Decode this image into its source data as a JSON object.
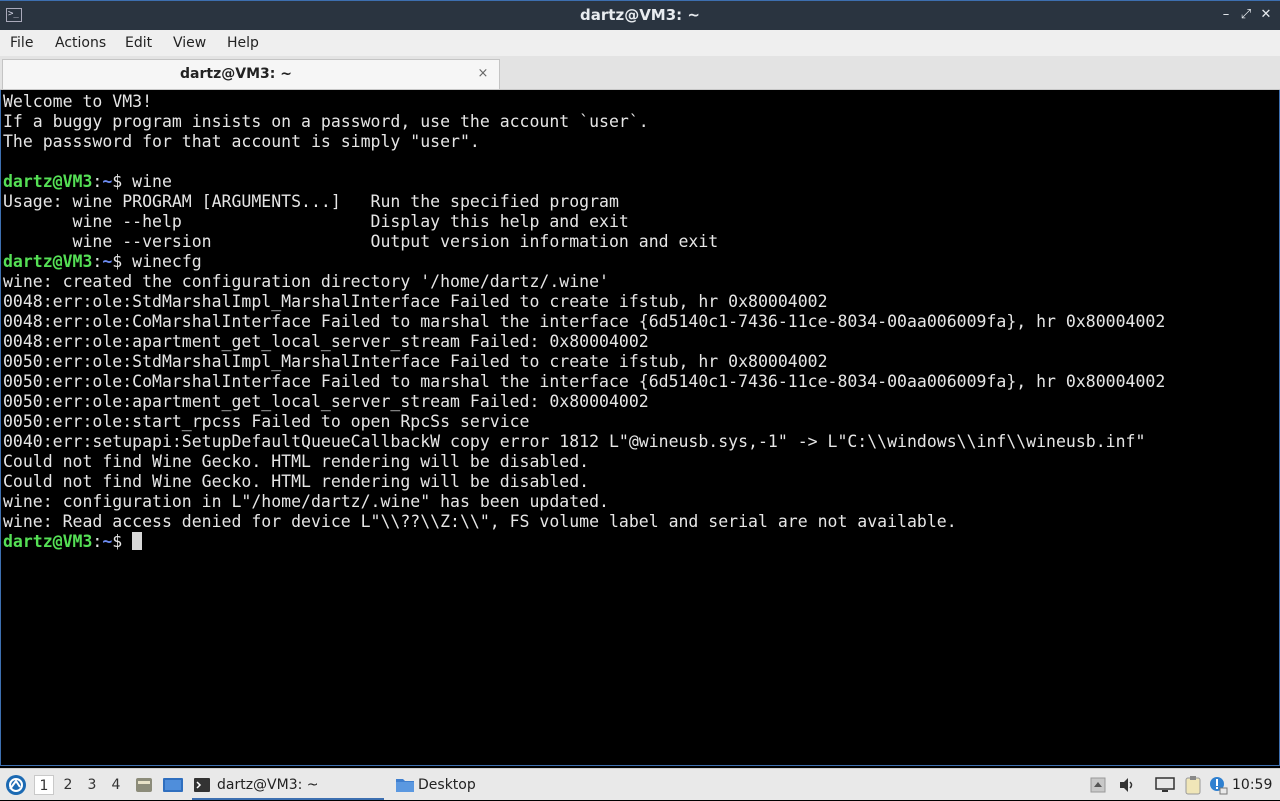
{
  "window": {
    "title": "dartz@VM3: ~",
    "app_icon": "terminal-icon",
    "buttons": [
      "minimize-icon",
      "maximize-icon",
      "close-icon"
    ]
  },
  "menu": [
    "File",
    "Actions",
    "Edit",
    "View",
    "Help"
  ],
  "tab": {
    "label": "dartz@VM3: ~",
    "close": "×"
  },
  "prompt": {
    "user_host": "dartz@VM3",
    "colon": ":",
    "path": "~",
    "sign": "$"
  },
  "terminal": {
    "lines": [
      {
        "text": "Welcome to VM3!"
      },
      {
        "text": "If a buggy program insists on a password, use the account `user`."
      },
      {
        "text": "The passsword for that account is simply \"user\"."
      },
      {
        "text": ""
      },
      {
        "prompt": true,
        "cmd": " wine"
      },
      {
        "text": "Usage: wine PROGRAM [ARGUMENTS...]   Run the specified program"
      },
      {
        "text": "       wine --help                   Display this help and exit"
      },
      {
        "text": "       wine --version                Output version information and exit"
      },
      {
        "prompt": true,
        "cmd": " winecfg"
      },
      {
        "text": "wine: created the configuration directory '/home/dartz/.wine'"
      },
      {
        "text": "0048:err:ole:StdMarshalImpl_MarshalInterface Failed to create ifstub, hr 0x80004002"
      },
      {
        "text": "0048:err:ole:CoMarshalInterface Failed to marshal the interface {6d5140c1-7436-11ce-8034-00aa006009fa}, hr 0x80004002"
      },
      {
        "text": "0048:err:ole:apartment_get_local_server_stream Failed: 0x80004002"
      },
      {
        "text": "0050:err:ole:StdMarshalImpl_MarshalInterface Failed to create ifstub, hr 0x80004002"
      },
      {
        "text": "0050:err:ole:CoMarshalInterface Failed to marshal the interface {6d5140c1-7436-11ce-8034-00aa006009fa}, hr 0x80004002"
      },
      {
        "text": "0050:err:ole:apartment_get_local_server_stream Failed: 0x80004002"
      },
      {
        "text": "0050:err:ole:start_rpcss Failed to open RpcSs service"
      },
      {
        "text": "0040:err:setupapi:SetupDefaultQueueCallbackW copy error 1812 L\"@wineusb.sys,-1\" -> L\"C:\\\\windows\\\\inf\\\\wineusb.inf\""
      },
      {
        "text": "Could not find Wine Gecko. HTML rendering will be disabled."
      },
      {
        "text": "Could not find Wine Gecko. HTML rendering will be disabled."
      },
      {
        "text": "wine: configuration in L\"/home/dartz/.wine\" has been updated."
      },
      {
        "text": "wine: Read access denied for device L\"\\\\??\\\\Z:\\\\\", FS volume label and serial are not available."
      },
      {
        "prompt": true,
        "cmd": " ",
        "cursor": true
      }
    ]
  },
  "taskbar": {
    "start_icon": "lubuntu-start-icon",
    "workspaces": [
      "1",
      "2",
      "3",
      "4"
    ],
    "active_workspace": "1",
    "launchers": [
      "file-manager-icon",
      "desktop-icon"
    ],
    "tasks": [
      {
        "label": "dartz@VM3: ~",
        "icon": "terminal-icon",
        "active": true
      },
      {
        "label": "Desktop",
        "icon": "folder-icon",
        "active": false
      }
    ],
    "tray": [
      "tray-expand-icon",
      "volume-icon",
      "network-icon",
      "clipboard-icon",
      "update-notifier-icon"
    ],
    "clock": "10:59"
  },
  "colors": {
    "titlebar": "#2a3440",
    "accent": "#3d6fb0",
    "prompt_user": "#55e055",
    "prompt_path": "#6e8df4",
    "terminal_bg": "#000000",
    "terminal_fg": "#e6e6e6"
  }
}
